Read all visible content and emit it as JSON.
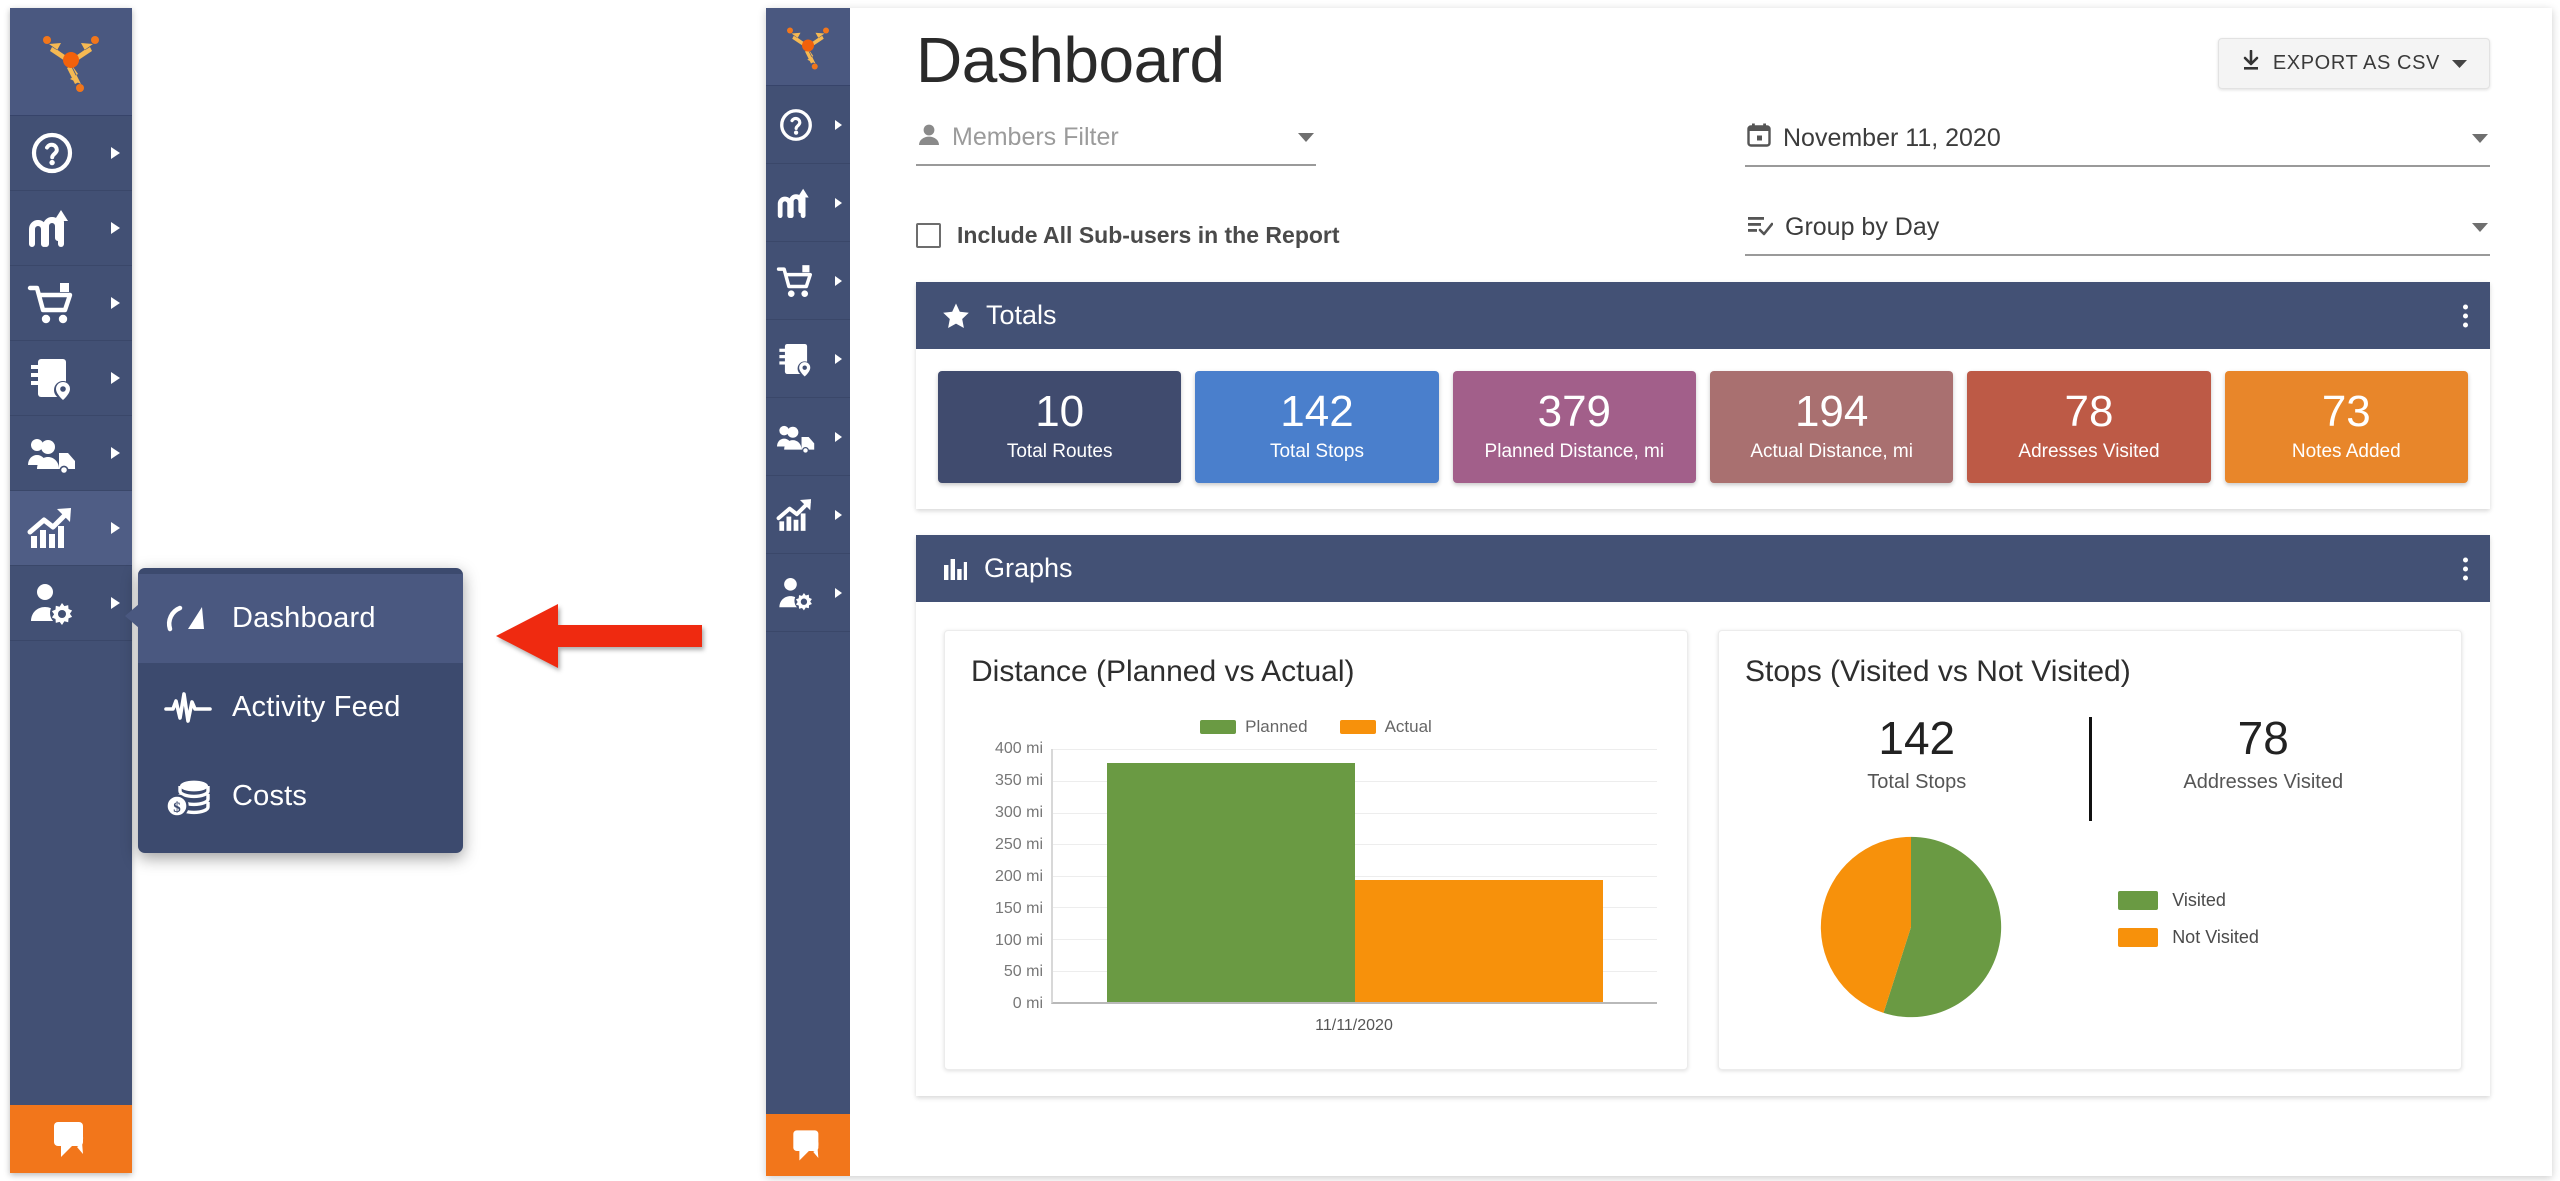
{
  "colors": {
    "sidebar": "#425074",
    "sidebar_active": "#4f5d85",
    "panel_header": "#435175",
    "accent_orange": "#f2761b",
    "annotation_arrow": "#ef2a10",
    "green": "#6a9a43",
    "orange": "#f7910b"
  },
  "outer_sidebar": {
    "logo_name": "route4me-logo-icon",
    "items": [
      {
        "icon": "help-circle-icon",
        "name": "help"
      },
      {
        "icon": "routes-icon",
        "name": "routes"
      },
      {
        "icon": "shopping-cart-icon",
        "name": "orders"
      },
      {
        "icon": "address-book-icon",
        "name": "address-book"
      },
      {
        "icon": "team-vehicle-icon",
        "name": "team"
      },
      {
        "icon": "analytics-growth-icon",
        "name": "analytics",
        "active": true
      },
      {
        "icon": "user-settings-icon",
        "name": "user-settings"
      }
    ],
    "chat_icon": "chat-bubble-icon"
  },
  "flyout_menu": {
    "items": [
      {
        "icon": "speedometer-icon",
        "label": "Dashboard",
        "selected": true
      },
      {
        "icon": "activity-pulse-icon",
        "label": "Activity Feed",
        "selected": false
      },
      {
        "icon": "coins-dollar-icon",
        "label": "Costs",
        "selected": false
      }
    ]
  },
  "annotation": {
    "arrow_name": "red-pointer-arrow",
    "direction": "left"
  },
  "inner_sidebar": {
    "logo_name": "route4me-logo-icon",
    "items": [
      {
        "icon": "help-circle-icon",
        "name": "help"
      },
      {
        "icon": "routes-icon",
        "name": "routes"
      },
      {
        "icon": "shopping-cart-icon",
        "name": "orders"
      },
      {
        "icon": "address-book-icon",
        "name": "address-book"
      },
      {
        "icon": "team-vehicle-icon",
        "name": "team"
      },
      {
        "icon": "analytics-growth-icon",
        "name": "analytics"
      },
      {
        "icon": "user-settings-icon",
        "name": "user-settings"
      }
    ],
    "chat_icon": "chat-bubble-icon"
  },
  "header": {
    "title": "Dashboard",
    "export_button": {
      "label": "EXPORT AS CSV",
      "icon": "download-icon",
      "caret": "chevron-down-icon"
    }
  },
  "filters": {
    "members": {
      "icon": "person-icon",
      "placeholder": "Members Filter",
      "value": ""
    },
    "include_subusers": {
      "label": "Include All Sub-users in the Report",
      "checked": false
    },
    "date": {
      "icon": "calendar-icon",
      "value": "November 11, 2020"
    },
    "group_by": {
      "icon": "list-check-icon",
      "value": "Group by Day"
    }
  },
  "totals_panel": {
    "icon": "star-icon",
    "title": "Totals",
    "menu_icon": "kebab-menu-icon",
    "cards": [
      {
        "value": "10",
        "label": "Total Routes",
        "color": "#404b6e"
      },
      {
        "value": "142",
        "label": "Total Stops",
        "color": "#4a7fcc"
      },
      {
        "value": "379",
        "label": "Planned Distance, mi",
        "color": "#a25f8a"
      },
      {
        "value": "194",
        "label": "Actual Distance, mi",
        "color": "#a97070"
      },
      {
        "value": "78",
        "label": "Adresses Visited",
        "color": "#bd5a46"
      },
      {
        "value": "73",
        "label": "Notes Added",
        "color": "#e8862a"
      }
    ]
  },
  "graphs_panel": {
    "icon": "bar-chart-icon",
    "title": "Graphs",
    "menu_icon": "kebab-menu-icon",
    "stops_card": {
      "title": "Stops (Visited vs Not Visited)",
      "kpis": [
        {
          "value": "142",
          "label": "Total Stops"
        },
        {
          "value": "78",
          "label": "Addresses Visited"
        }
      ]
    }
  },
  "chart_data": [
    {
      "type": "bar",
      "title": "Distance (Planned vs Actual)",
      "categories": [
        "11/11/2020"
      ],
      "series": [
        {
          "name": "Planned",
          "values": [
            379
          ],
          "color": "#6a9a43"
        },
        {
          "name": "Actual",
          "values": [
            194
          ],
          "color": "#f7910b"
        }
      ],
      "xlabel": "",
      "ylabel": "",
      "ylim": [
        0,
        400
      ],
      "yticks": [
        "0 mi",
        "50 mi",
        "100 mi",
        "150 mi",
        "200 mi",
        "250 mi",
        "300 mi",
        "350 mi",
        "400 mi"
      ],
      "grid": true,
      "legend_position": "top-center",
      "unit": "mi"
    },
    {
      "type": "pie",
      "title": "Stops (Visited vs Not Visited)",
      "labels": [
        "Visited",
        "Not Visited"
      ],
      "values": [
        78,
        64
      ],
      "colors": [
        "#6a9a43",
        "#f7910b"
      ],
      "total": 142,
      "legend_position": "right"
    }
  ]
}
